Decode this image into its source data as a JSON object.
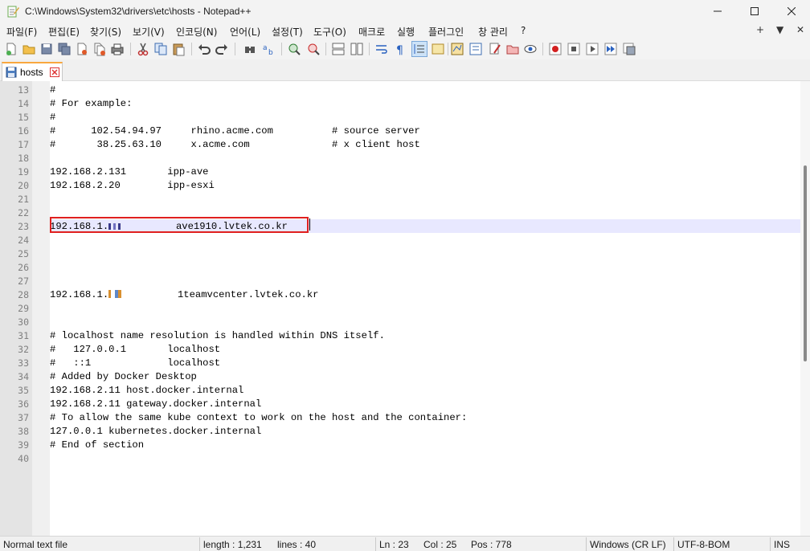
{
  "window": {
    "title": "C:\\Windows\\System32\\drivers\\etc\\hosts - Notepad++",
    "icons": {
      "app": "notepad-plus-plus-icon",
      "minimize": "minimize-icon",
      "maximize": "maximize-icon",
      "close": "close-icon"
    }
  },
  "menu": {
    "items": [
      "파일(F)",
      "편집(E)",
      "찾기(S)",
      "보기(V)",
      "인코딩(N)",
      "언어(L)",
      "설정(T)",
      "도구(O)",
      "매크로",
      "실행",
      "플러그인",
      "창 관리",
      "?"
    ],
    "right": [
      "+",
      "▼",
      "✕"
    ]
  },
  "toolbar": {
    "buttons": [
      "new-file",
      "open-file",
      "save",
      "save-all",
      "close",
      "close-all",
      "print",
      "cut",
      "copy",
      "paste",
      "undo",
      "redo",
      "find",
      "replace",
      "zoom-in",
      "zoom-out",
      "sync-vertical",
      "sync-horizontal",
      "word-wrap",
      "show-all-chars",
      "indent-guide",
      "define-language",
      "doc-map",
      "function-list",
      "folder-as-workspace",
      "doc-switcher",
      "monitoring",
      "record-macro",
      "stop-record",
      "play-macro",
      "run-macro-multiple",
      "save-macro"
    ]
  },
  "tab": {
    "label": "hosts",
    "icon": "save-icon",
    "close": "tab-close-icon"
  },
  "editor": {
    "lines": [
      {
        "n": "13",
        "text": "#"
      },
      {
        "n": "14",
        "text": "# For example:"
      },
      {
        "n": "15",
        "text": "#"
      },
      {
        "n": "16",
        "text": "#      102.54.94.97     rhino.acme.com          # source server"
      },
      {
        "n": "17",
        "text": "#       38.25.63.10     x.acme.com              # x client host"
      },
      {
        "n": "18",
        "text": ""
      },
      {
        "n": "19",
        "text": "192.168.2.131       ipp-ave"
      },
      {
        "n": "20",
        "text": "192.168.2.20        ipp-esxi"
      },
      {
        "n": "21",
        "text": ""
      },
      {
        "n": "22",
        "text": ""
      },
      {
        "n": "23",
        "text": "192.168.1.",
        "redacted": true,
        "after": "         ave1910.lvtek.co.kr",
        "current": true
      },
      {
        "n": "24",
        "text": ""
      },
      {
        "n": "25",
        "text": ""
      },
      {
        "n": "26",
        "text": ""
      },
      {
        "n": "27",
        "text": ""
      },
      {
        "n": "28",
        "text": "192.168.1.",
        "redacted2": true,
        "after": "         1teamvcenter.lvtek.co.kr"
      },
      {
        "n": "29",
        "text": ""
      },
      {
        "n": "30",
        "text": ""
      },
      {
        "n": "31",
        "text": "# localhost name resolution is handled within DNS itself."
      },
      {
        "n": "32",
        "text": "#   127.0.0.1       localhost"
      },
      {
        "n": "33",
        "text": "#   ::1             localhost"
      },
      {
        "n": "34",
        "text": "# Added by Docker Desktop"
      },
      {
        "n": "35",
        "text": "192.168.2.11 host.docker.internal"
      },
      {
        "n": "36",
        "text": "192.168.2.11 gateway.docker.internal"
      },
      {
        "n": "37",
        "text": "# To allow the same kube context to work on the host and the container:"
      },
      {
        "n": "38",
        "text": "127.0.0.1 kubernetes.docker.internal"
      },
      {
        "n": "39",
        "text": "# End of section"
      },
      {
        "n": "40",
        "text": ""
      }
    ]
  },
  "status": {
    "file_type": "Normal text file",
    "length": "length : 1,231",
    "lines": "lines : 40",
    "ln": "Ln : 23",
    "col": "Col : 25",
    "pos": "Pos : 778",
    "eol": "Windows (CR LF)",
    "encoding": "UTF-8-BOM",
    "mode": "INS"
  },
  "colors": {
    "current_line": "#e8e8ff",
    "highlight_border": "#e0201f",
    "tab_accent": "#f9a73e"
  }
}
